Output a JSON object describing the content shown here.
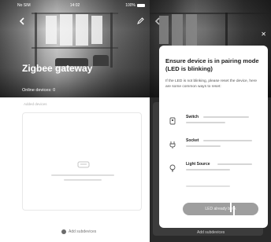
{
  "left": {
    "status": {
      "carrier": "No SIM",
      "time": "14:02",
      "battery": "100%"
    },
    "gateway_title": "Zigbee gateway",
    "online_devices": "Online devices: 0",
    "section_label": "Added devices",
    "empty_state_icon": "cloud-icon",
    "bottom_link": "Add subdevices"
  },
  "right": {
    "modal": {
      "title": "Ensure device is in pairing mode (LED is blinking)",
      "description": "If the LED is not blinking, please reset the device, here are some common ways to reset:",
      "devices": [
        {
          "name": "Switch",
          "icon": "switch-icon"
        },
        {
          "name": "Socket",
          "icon": "plug-icon"
        },
        {
          "name": "Light Source",
          "icon": "bulb-icon"
        }
      ],
      "confirm_label": "LED already blink"
    },
    "bottom_link": "Add subdevices"
  }
}
